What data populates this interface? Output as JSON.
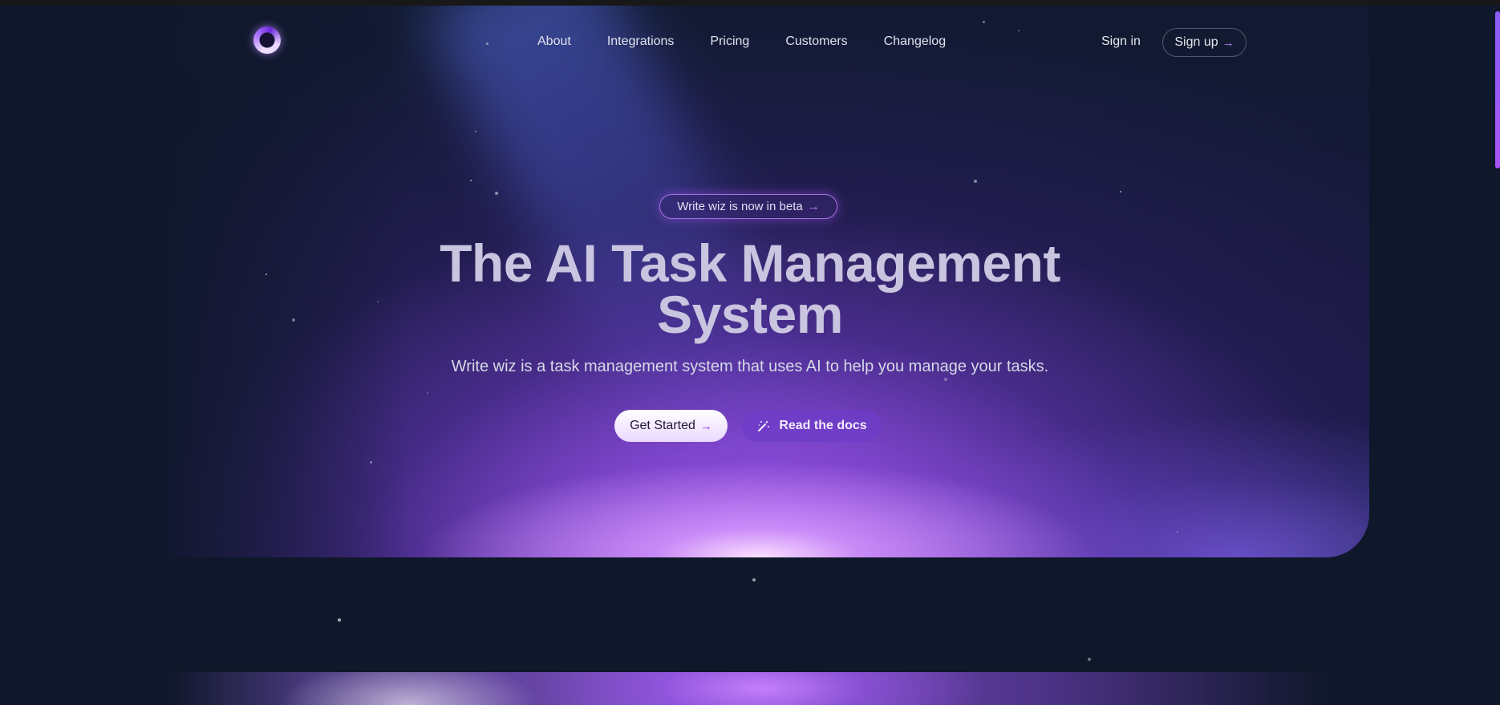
{
  "nav": {
    "logo": "write-wiz-logo",
    "links": [
      "About",
      "Integrations",
      "Pricing",
      "Customers",
      "Changelog"
    ],
    "sign_in": "Sign in",
    "sign_up": "Sign up"
  },
  "hero": {
    "badge": "Write wiz is now in beta",
    "title_line1": "The AI Task Management",
    "title_line2": "System",
    "subtitle": "Write wiz is a task management system that uses AI to help you manage your tasks.",
    "primary_cta": "Get Started",
    "secondary_cta": "Read the docs"
  },
  "icons": {
    "arrow": "→",
    "secondary_cta_icon": "magic-wand-icon"
  },
  "colors": {
    "background": "#0f172a",
    "accent": "#a855f7",
    "accent_light": "#c084fc"
  }
}
